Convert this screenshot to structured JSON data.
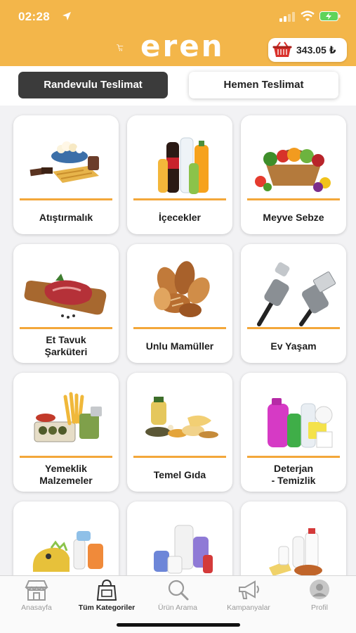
{
  "status_bar": {
    "time": "02:28"
  },
  "header": {
    "brand": "eren",
    "cart_amount": "343.05 ₺"
  },
  "delivery_tabs": [
    {
      "label": "Randevulu Teslimat",
      "active": true
    },
    {
      "label": "Hemen Teslimat",
      "active": false
    }
  ],
  "categories": [
    {
      "label": "Atıştırmalık",
      "icon": "snacks-image"
    },
    {
      "label": "İçecekler",
      "icon": "drinks-image"
    },
    {
      "label": "Meyve Sebze",
      "icon": "fruit-vegetable-image"
    },
    {
      "label": "Et Tavuk\nŞarküteri",
      "icon": "meat-image"
    },
    {
      "label": "Unlu Mamüller",
      "icon": "bakery-image"
    },
    {
      "label": "Ev Yaşam",
      "icon": "usb-cable-image"
    },
    {
      "label": "Yemeklik\nMalzemeler",
      "icon": "cooking-ingredients-image"
    },
    {
      "label": "Temel Gıda",
      "icon": "staple-food-image"
    },
    {
      "label": "Deterjan\n- Temizlik",
      "icon": "detergent-image"
    },
    {
      "label": "",
      "icon": "baby-toys-image"
    },
    {
      "label": "",
      "icon": "personal-care-image"
    },
    {
      "label": "",
      "icon": "dairy-image"
    }
  ],
  "bottom_nav": [
    {
      "label": "Anasayfa",
      "icon": "store-icon",
      "active": false
    },
    {
      "label": "Tüm Kategoriler",
      "icon": "shopping-bag-icon",
      "active": true
    },
    {
      "label": "Ürün Arama",
      "icon": "magnifier-icon",
      "active": false
    },
    {
      "label": "Kampanyalar",
      "icon": "megaphone-icon",
      "active": false
    },
    {
      "label": "Profil",
      "icon": "person-icon",
      "active": false
    }
  ],
  "colors": {
    "brand": "#f3b64a",
    "accent_line": "#f3a73a",
    "active_tab": "#3b3b3b"
  }
}
